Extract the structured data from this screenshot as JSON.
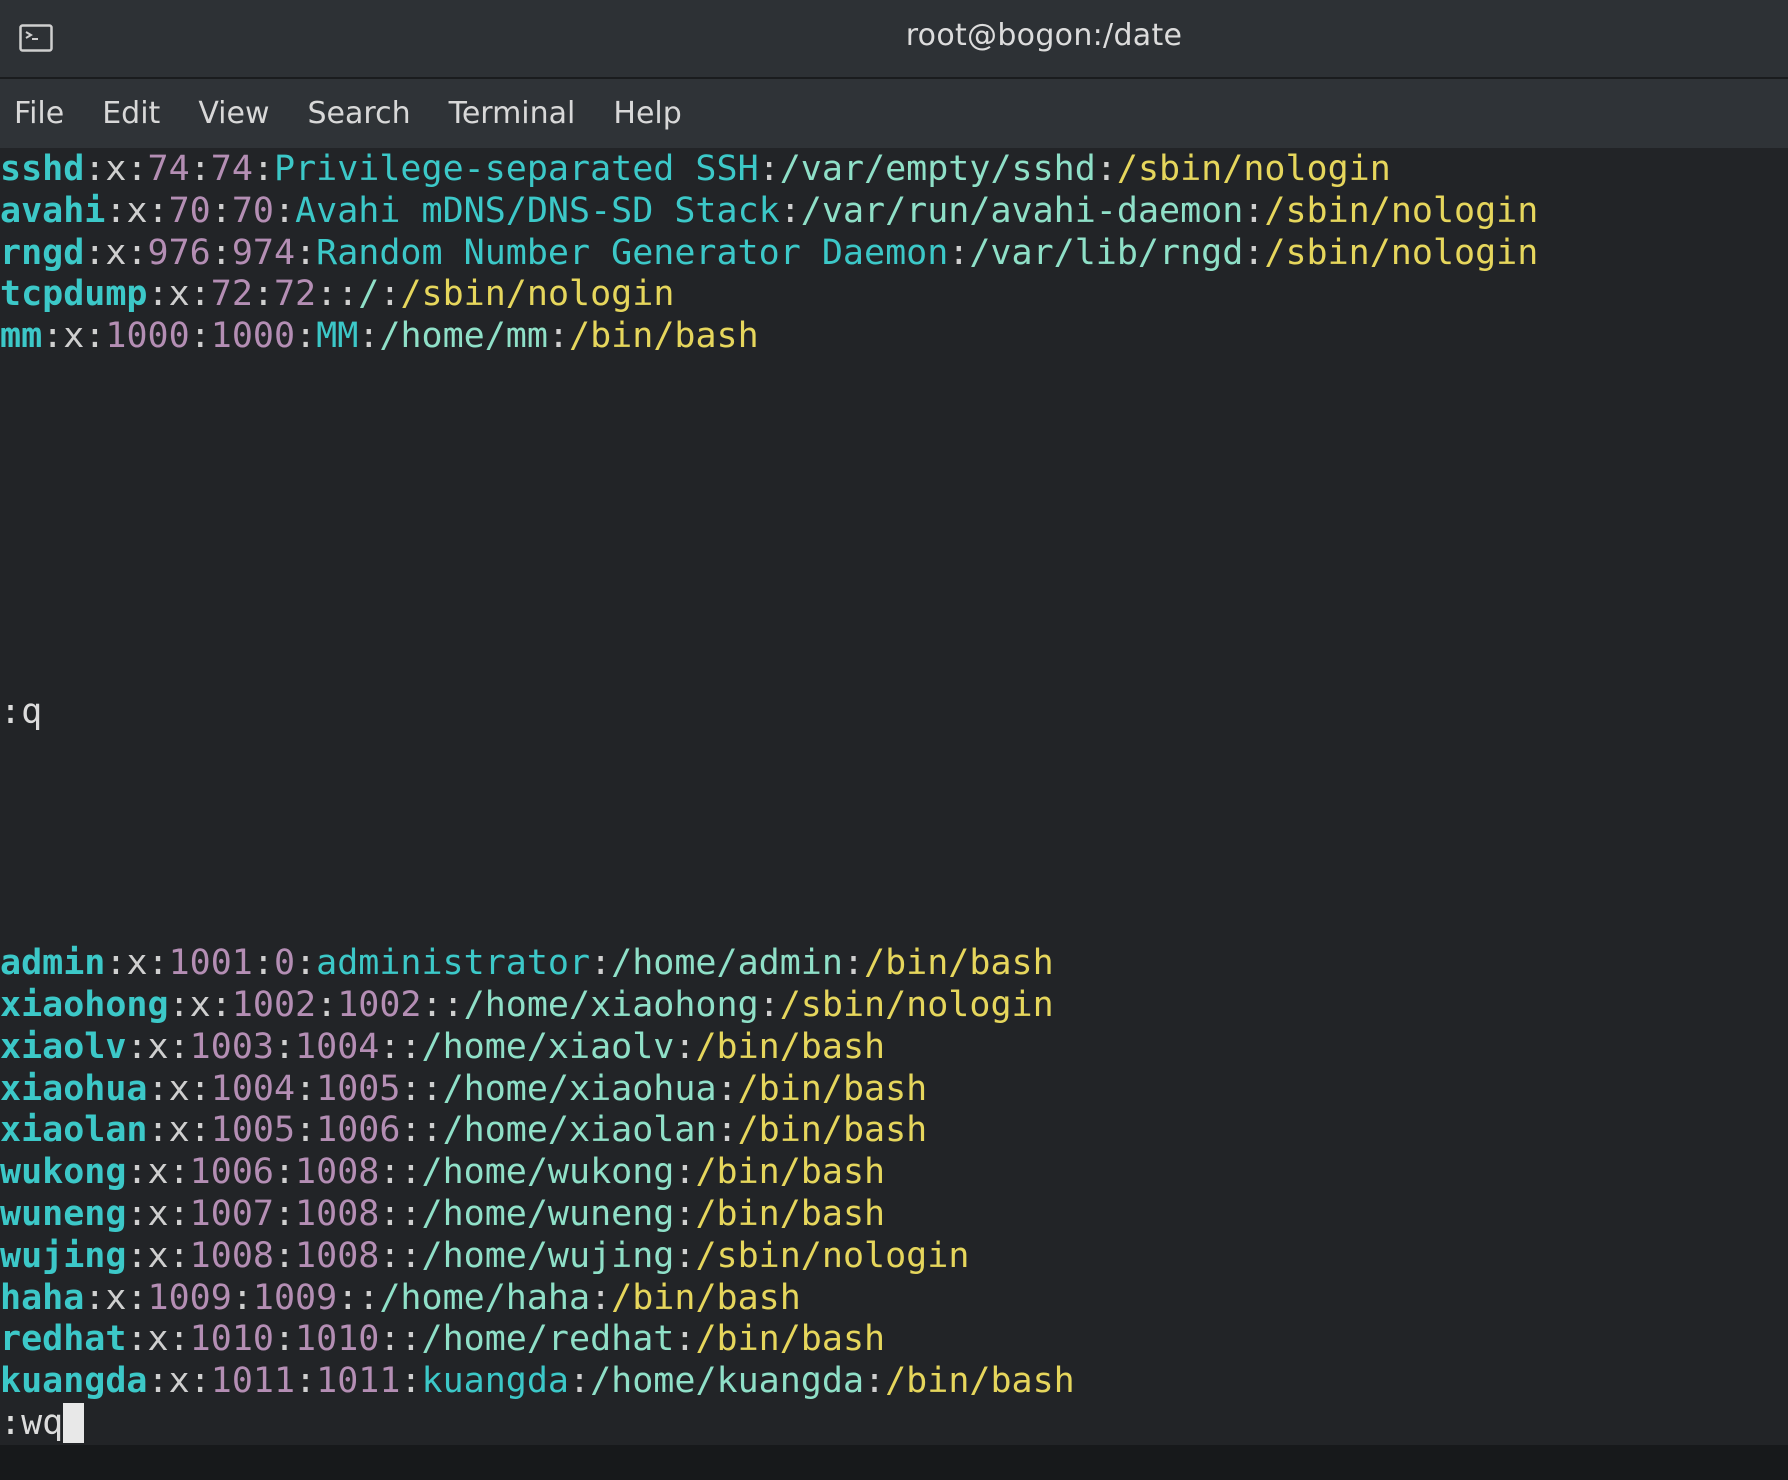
{
  "window": {
    "title": "root@bogon:/date",
    "icon": "terminal-icon"
  },
  "menu": [
    "File",
    "Edit",
    "View",
    "Search",
    "Terminal",
    "Help"
  ],
  "colors": {
    "username": "#3cc8c8",
    "number": "#b48eb4",
    "description": "#3cc8c8",
    "home": "#8fe0c8",
    "shell": "#e6d65c",
    "background": "#222427"
  },
  "top_entries": [
    {
      "user": "sshd",
      "pw": "x",
      "uid": "74",
      "gid": "74",
      "desc": "Privilege-separated SSH",
      "home": "/var/empty/sshd",
      "shell": "/sbin/nologin"
    },
    {
      "user": "avahi",
      "pw": "x",
      "uid": "70",
      "gid": "70",
      "desc": "Avahi mDNS/DNS-SD Stack",
      "home": "/var/run/avahi-daemon",
      "shell": "/sbin/nologin"
    },
    {
      "user": "rngd",
      "pw": "x",
      "uid": "976",
      "gid": "974",
      "desc": "Random Number Generator Daemon",
      "home": "/var/lib/rngd",
      "shell": "/sbin/nologin"
    },
    {
      "user": "tcpdump",
      "pw": "x",
      "uid": "72",
      "gid": "72",
      "desc": "",
      "home": "/",
      "shell": "/sbin/nologin"
    },
    {
      "user": "mm",
      "pw": "x",
      "uid": "1000",
      "gid": "1000",
      "desc": "MM",
      "home": "/home/mm",
      "shell": "/bin/bash"
    }
  ],
  "quit_command": ":q",
  "bottom_entries": [
    {
      "user": "admin",
      "pw": "x",
      "uid": "1001",
      "gid": "0",
      "desc": "administrator",
      "home": "/home/admin",
      "shell": "/bin/bash"
    },
    {
      "user": "xiaohong",
      "pw": "x",
      "uid": "1002",
      "gid": "1002",
      "desc": "",
      "home": "/home/xiaohong",
      "shell": "/sbin/nologin"
    },
    {
      "user": "xiaolv",
      "pw": "x",
      "uid": "1003",
      "gid": "1004",
      "desc": "",
      "home": "/home/xiaolv",
      "shell": "/bin/bash"
    },
    {
      "user": "xiaohua",
      "pw": "x",
      "uid": "1004",
      "gid": "1005",
      "desc": "",
      "home": "/home/xiaohua",
      "shell": "/bin/bash"
    },
    {
      "user": "xiaolan",
      "pw": "x",
      "uid": "1005",
      "gid": "1006",
      "desc": "",
      "home": "/home/xiaolan",
      "shell": "/bin/bash"
    },
    {
      "user": "wukong",
      "pw": "x",
      "uid": "1006",
      "gid": "1008",
      "desc": "",
      "home": "/home/wukong",
      "shell": "/bin/bash"
    },
    {
      "user": "wuneng",
      "pw": "x",
      "uid": "1007",
      "gid": "1008",
      "desc": "",
      "home": "/home/wuneng",
      "shell": "/bin/bash"
    },
    {
      "user": "wujing",
      "pw": "x",
      "uid": "1008",
      "gid": "1008",
      "desc": "",
      "home": "/home/wujing",
      "shell": "/sbin/nologin"
    },
    {
      "user": "haha",
      "pw": "x",
      "uid": "1009",
      "gid": "1009",
      "desc": "",
      "home": "/home/haha",
      "shell": "/bin/bash"
    },
    {
      "user": "redhat",
      "pw": "x",
      "uid": "1010",
      "gid": "1010",
      "desc": "",
      "home": "/home/redhat",
      "shell": "/bin/bash"
    },
    {
      "user": "kuangda",
      "pw": "x",
      "uid": "1011",
      "gid": "1011",
      "desc": "kuangda",
      "home": "/home/kuangda",
      "shell": "/bin/bash"
    }
  ],
  "command_line": ":wq"
}
